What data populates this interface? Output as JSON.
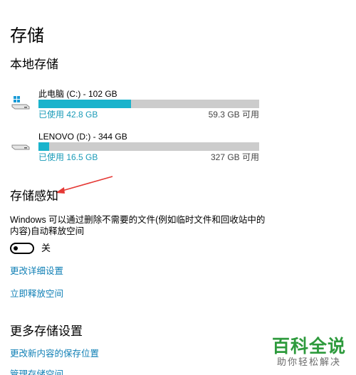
{
  "page": {
    "title": "存储"
  },
  "local_storage": {
    "title": "本地存储",
    "drives": [
      {
        "name": "此电脑 (C:) - 102 GB",
        "used": "已使用 42.8 GB",
        "free": "59.3 GB 可用",
        "used_fraction": 0.42,
        "icon": "windows-drive-icon"
      },
      {
        "name": "LENOVO (D:) - 344 GB",
        "used": "已使用 16.5 GB",
        "free": "327 GB 可用",
        "used_fraction": 0.048,
        "icon": "drive-icon"
      }
    ]
  },
  "storage_sense": {
    "title": "存储感知",
    "description": "Windows 可以通过删除不需要的文件(例如临时文件和回收站中的内容)自动释放空间",
    "toggle_state": "关",
    "links": {
      "change_settings": "更改详细设置",
      "free_now": "立即释放空间"
    }
  },
  "more_settings": {
    "title": "更多存储设置",
    "links": {
      "change_save_location": "更改新内容的保存位置",
      "manage_spaces": "管理存储空间"
    }
  },
  "watermark": {
    "main": "百科全说",
    "sub": "助你轻松解决"
  },
  "colors": {
    "accent": "#1ab3cc",
    "link": "#0f7fb5",
    "bar_background": "#cccccc",
    "annotation_arrow": "#e53935",
    "watermark": "#2d9a3c"
  }
}
